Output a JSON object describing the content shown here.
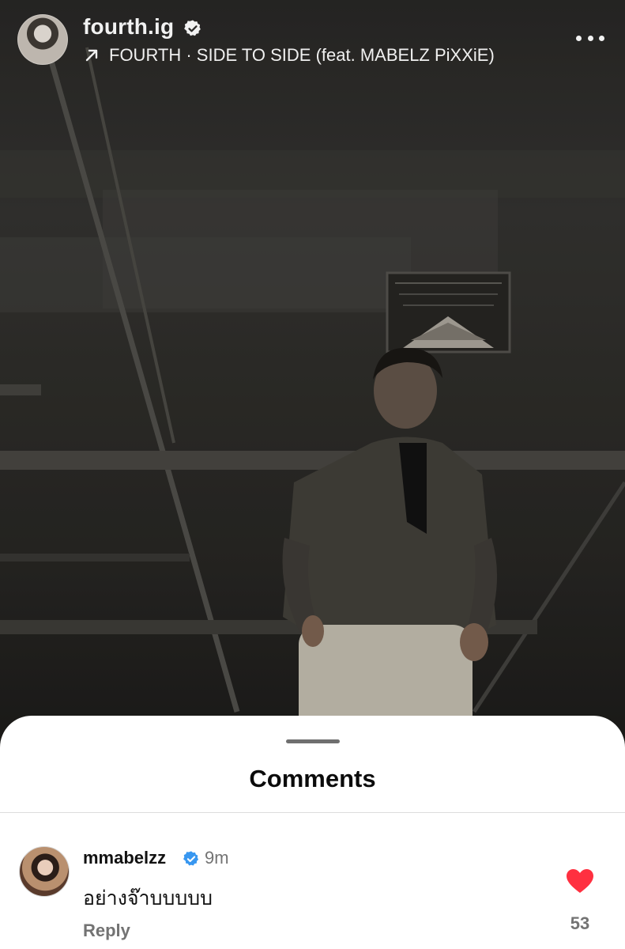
{
  "post": {
    "username": "fourth.ig",
    "audio_label": "FOURTH · SIDE TO SIDE (feat. MABELZ PiXXiE)",
    "icons": {
      "avatar": "avatar",
      "verified": "verified-badge-icon",
      "audio": "arrow-up-right-icon",
      "more": "more-options-icon"
    }
  },
  "comments": {
    "title": "Comments",
    "items": [
      {
        "username": "mmabelzz",
        "time": "9m",
        "text": "อย่างจ๊าบบบบบ",
        "reply_label": "Reply",
        "like_count": "53",
        "liked": true
      }
    ]
  },
  "colors": {
    "verified": "#3897f0",
    "like": "#ff3040",
    "secondary_text": "#737373"
  }
}
